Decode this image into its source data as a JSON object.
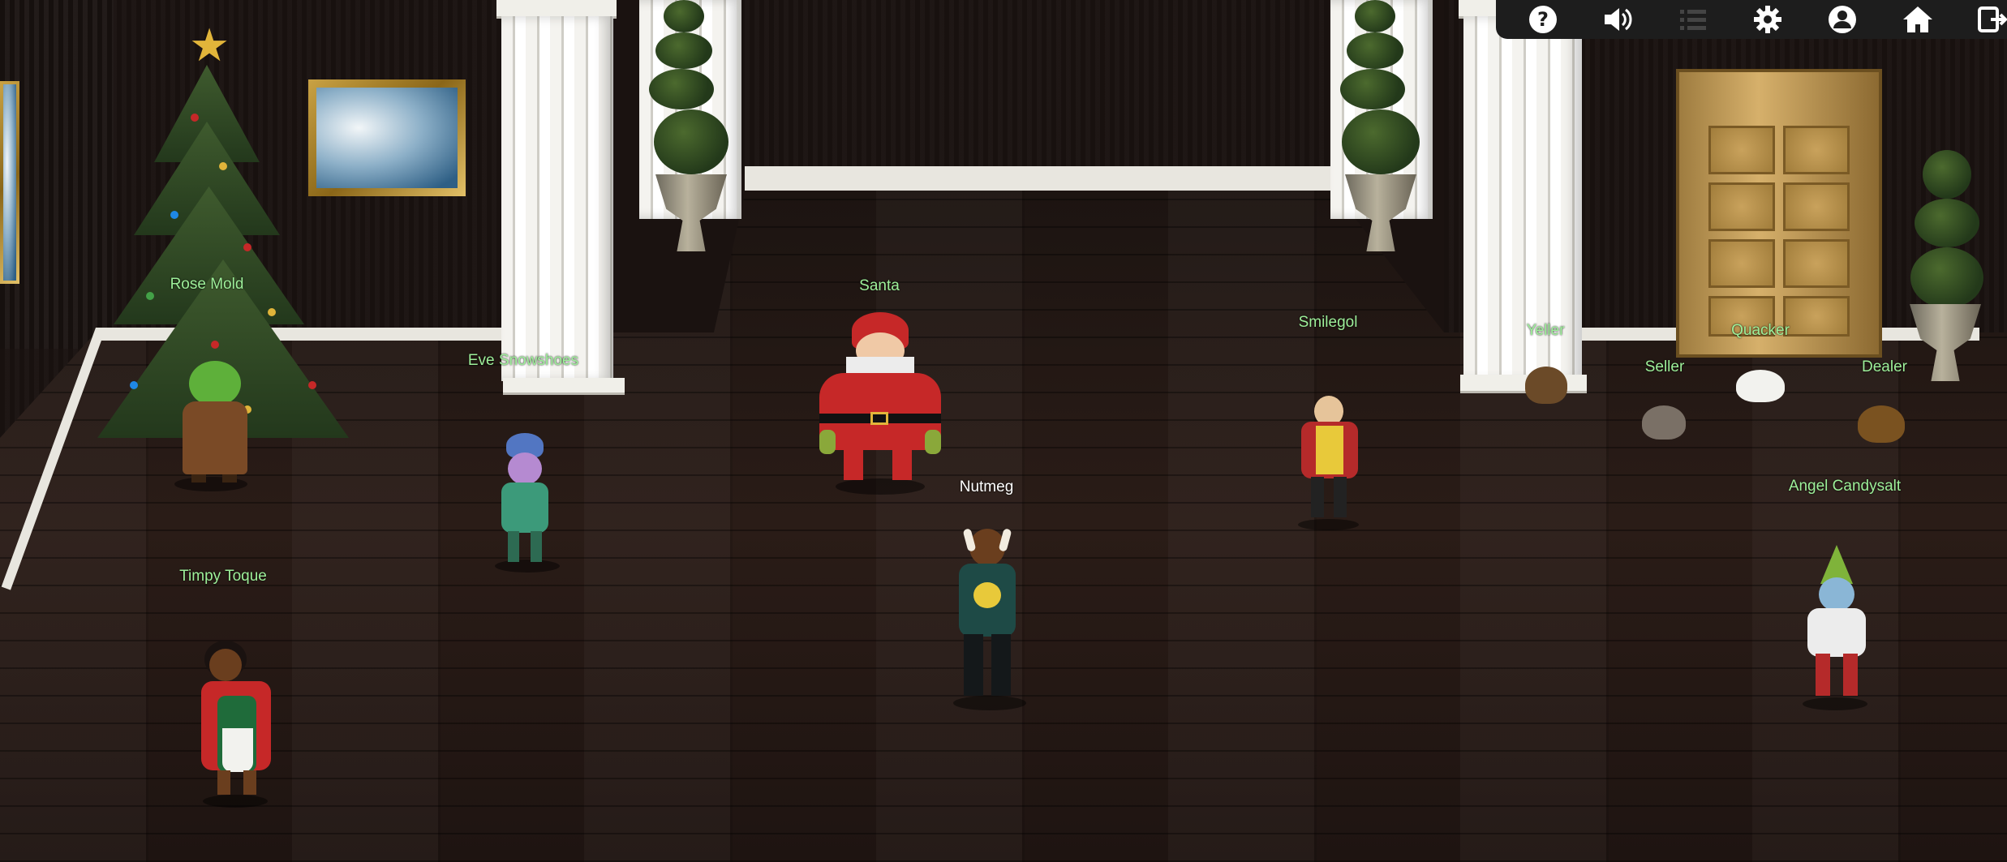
{
  "toolbar": {
    "buttons": [
      {
        "name": "help-icon"
      },
      {
        "name": "volume-icon"
      },
      {
        "name": "list-icon"
      },
      {
        "name": "settings-gear-icon"
      },
      {
        "name": "profile-icon"
      },
      {
        "name": "home-icon"
      },
      {
        "name": "exit-icon"
      }
    ],
    "background": "#1d1d1d"
  },
  "characters": {
    "rose_mold": "Rose Mold",
    "eve_snowshoes": "Eve Snowshoes",
    "santa": "Santa",
    "smilegol": "Smilegol",
    "yeller": "Yeller",
    "seller": "Seller",
    "quacker": "Quacker",
    "dealer": "Dealer",
    "nutmeg": "Nutmeg",
    "angel_candysalt": "Angel Candysalt",
    "timpy_toque": "Timpy Toque"
  },
  "colors": {
    "npc_label": "#9ef09a",
    "player_label": "#ffffff",
    "wall": "#4a0f0c",
    "floor": "#241813"
  }
}
